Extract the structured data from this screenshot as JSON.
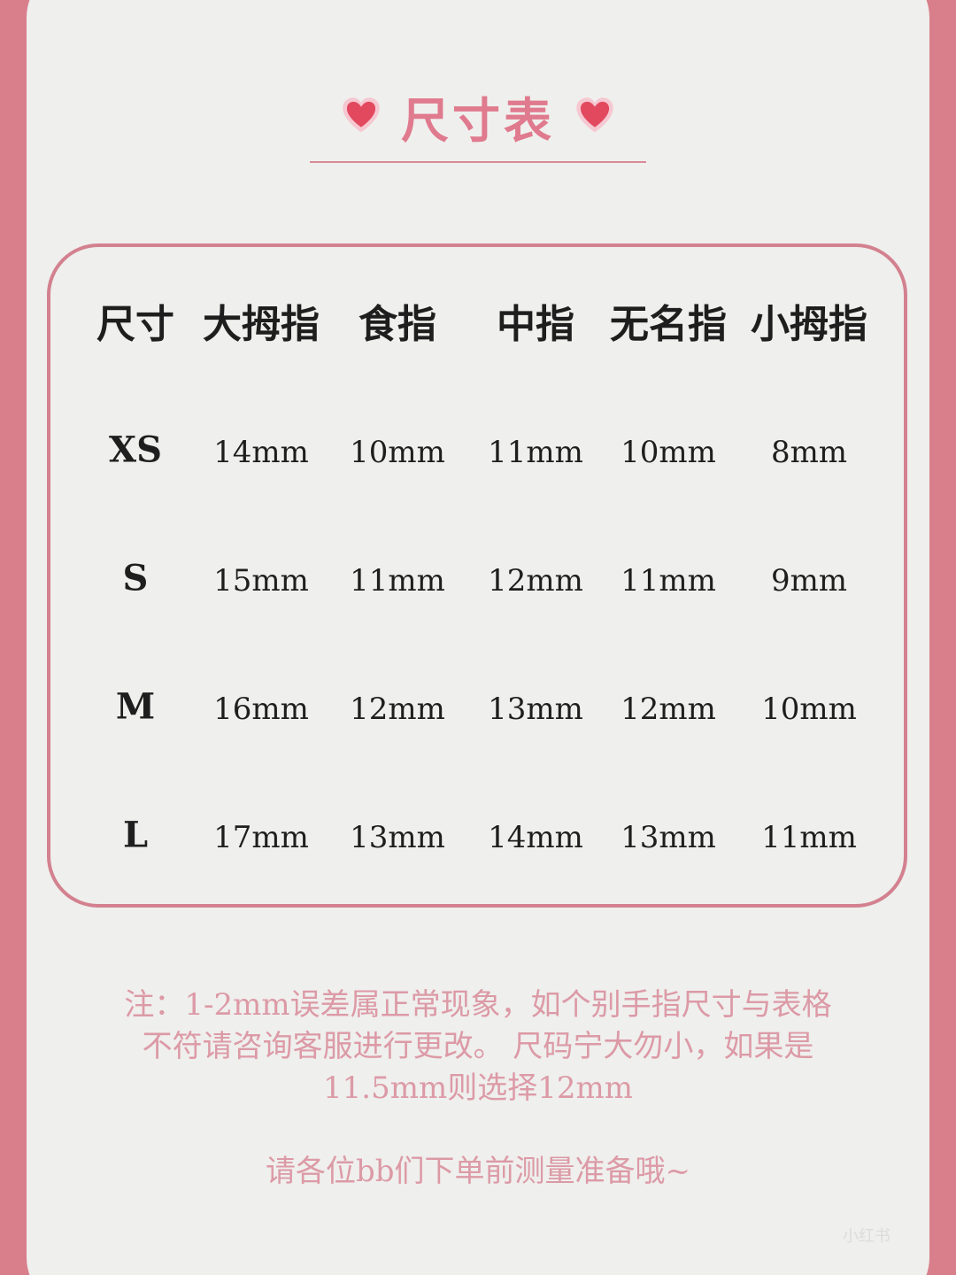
{
  "title": "尺寸表",
  "headers": [
    "尺寸",
    "大拇指",
    "食指",
    "中指",
    "无名指",
    "小拇指"
  ],
  "rows": [
    {
      "size": "XS",
      "values": [
        "14mm",
        "10mm",
        "11mm",
        "10mm",
        "8mm"
      ]
    },
    {
      "size": "S",
      "values": [
        "15mm",
        "11mm",
        "12mm",
        "11mm",
        "9mm"
      ]
    },
    {
      "size": "M",
      "values": [
        "16mm",
        "12mm",
        "13mm",
        "12mm",
        "10mm"
      ]
    },
    {
      "size": "L",
      "values": [
        "17mm",
        "13mm",
        "14mm",
        "13mm",
        "11mm"
      ]
    }
  ],
  "notes": {
    "line1": "注：1-2mm误差属正常现象，如个别手指尺寸与表格",
    "line2": "不符请咨询客服进行更改。 尺码宁大勿小，如果是",
    "line3": "11.5mm则选择12mm",
    "closing": "请各位bb们下单前测量准备哦~"
  },
  "watermark": "小红书",
  "colors": {
    "background": "#d87f8b",
    "card": "#efefed",
    "accent": "#e07a8e",
    "note_text": "#dc9aa6"
  },
  "icons": [
    "heart-icon",
    "heart-icon"
  ]
}
